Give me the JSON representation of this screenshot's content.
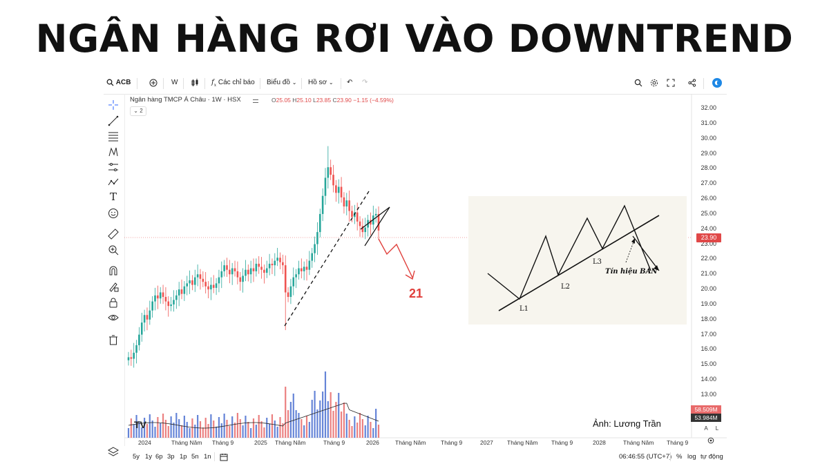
{
  "headline": "NGÂN HÀNG RƠI VÀO DOWNTREND",
  "toolbar": {
    "symbol": "ACB",
    "interval": "W",
    "indicators": "Các chỉ báo",
    "chart_menu": "Biểu đồ",
    "profile_menu": "Hồ sơ"
  },
  "legend": {
    "title": "Ngân hàng TMCP Á Châu · 1W · HSX",
    "open_label": "O",
    "open": "25.05",
    "high_label": "H",
    "high": "25.10",
    "low_label": "L",
    "low": "23.85",
    "close_label": "C",
    "close": "23.90",
    "change": "−1.15 (−4.59%)",
    "collapse": "2"
  },
  "price_axis": [
    "32.00",
    "31.00",
    "30.00",
    "29.00",
    "28.00",
    "27.00",
    "26.00",
    "25.00",
    "24.00",
    "23.00",
    "22.00",
    "21.00",
    "20.00",
    "19.00",
    "18.00",
    "17.00",
    "16.00",
    "15.00",
    "14.00",
    "13.00"
  ],
  "last_price_tag": "23.90",
  "volume_tags": [
    "58.509M",
    "53.984M"
  ],
  "time_axis": [
    "2024",
    "Tháng Năm",
    "Tháng 9",
    "2025",
    "Tháng Năm",
    "Tháng 9",
    "2026",
    "Tháng Năm",
    "Tháng 9",
    "2027",
    "Tháng Năm",
    "Tháng 9",
    "2028",
    "Tháng Năm",
    "Tháng 9"
  ],
  "annotations": {
    "target": "21",
    "credit": "Ảnh: Lương Trần"
  },
  "diagram": {
    "l1": "L1",
    "l2": "L2",
    "l3": "L3",
    "signal": "Tín hiệu BÁN"
  },
  "bottom": {
    "ranges": [
      "5y",
      "1y",
      "6p",
      "3p",
      "1p",
      "5n",
      "1n"
    ],
    "time": "06:46:55 (UTC+7)",
    "percent": "%",
    "log": "log",
    "auto": "tự động",
    "axis_a": "A",
    "axis_l": "L"
  },
  "colors": {
    "up": "#26a69a",
    "down": "#ef5350",
    "vol_up": "#4a6fd0",
    "vol_down": "#e86a6a",
    "arrow": "#e0403c"
  }
}
